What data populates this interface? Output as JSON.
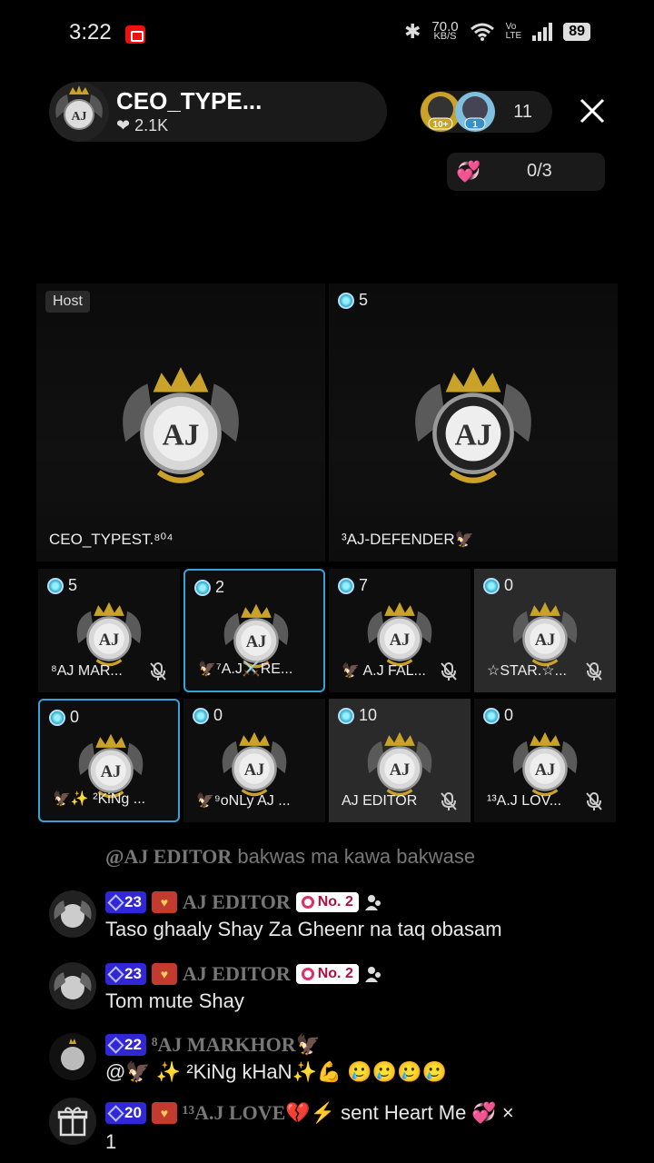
{
  "status_bar": {
    "time": "3:22",
    "net_speed_value": "70.0",
    "net_speed_unit": "KB/S",
    "volte_top": "Vo",
    "volte_bottom": "LTE",
    "battery": "89"
  },
  "header": {
    "host_name": "CEO_TYPE...",
    "host_likes": "❤ 2.1K",
    "viewer_badge_1": "10+",
    "viewer_badge_2": "1",
    "viewer_count": "11",
    "pk_count": "0/3"
  },
  "seats": [
    {
      "tag": "Host",
      "score": "",
      "name": "CEO_TYPEST.⁸⁰⁴",
      "muted": false
    },
    {
      "tag": "",
      "score": "5",
      "name": "³AJ-DEFENDER🦅",
      "muted": false
    },
    {
      "tag": "",
      "score": "5",
      "name": "⁸AJ MAR...",
      "muted": true
    },
    {
      "tag": "",
      "score": "2",
      "name": "🦅⁷A.J⚔️RE...",
      "muted": false
    },
    {
      "tag": "",
      "score": "7",
      "name": "🦅 A.J FAL...",
      "muted": true
    },
    {
      "tag": "",
      "score": "0",
      "name": "☆STAR.☆...",
      "muted": true
    },
    {
      "tag": "",
      "score": "0",
      "name": "🦅✨ ²KiNg ...",
      "muted": false
    },
    {
      "tag": "",
      "score": "0",
      "name": "🦅⁹oNLy AJ ...",
      "muted": false
    },
    {
      "tag": "",
      "score": "10",
      "name": "AJ EDITOR",
      "muted": true
    },
    {
      "tag": "",
      "score": "0",
      "name": "¹³A.J LOV...",
      "muted": true
    }
  ],
  "chat": {
    "ghost": {
      "name": "@AJ EDITOR",
      "text": "bakwas ma kawa bakwase"
    },
    "messages": [
      {
        "level": "23",
        "name": "AJ EDITOR",
        "rank": "No. 2",
        "text": "Taso ghaaly Shay Za Gheenr na taq obasam"
      },
      {
        "level": "23",
        "name": "AJ EDITOR",
        "rank": "No. 2",
        "text": "Tom mute Shay"
      },
      {
        "level": "22",
        "name": "⁸AJ MARKHOR🦅",
        "rank": "",
        "text": "@🦅 ✨ ²KiNg kHaN✨💪 🥲🥲🥲🥲"
      },
      {
        "level": "20",
        "name": "¹³A.J LOVE💔⚡",
        "rank": "",
        "text": "sent Heart Me 💞 ×",
        "text2": "1"
      }
    ]
  },
  "colors": {
    "background": "#000000",
    "selected_seat_border": "#3aa0d6",
    "level_badge": "#3227d6",
    "rank_badge_text": "#b01040"
  },
  "icons": [
    "bluetooth-icon",
    "wifi-icon",
    "signal-icon",
    "close-icon",
    "pk-heart-icon",
    "gem-icon",
    "mic-muted-icon",
    "gift-icon",
    "people-icon"
  ]
}
